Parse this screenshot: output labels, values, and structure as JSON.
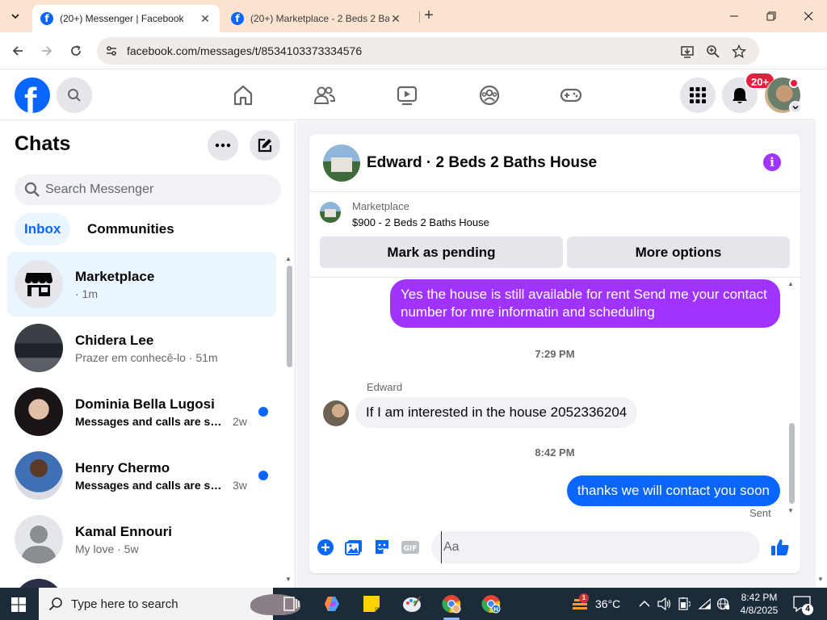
{
  "browser": {
    "tabs": [
      {
        "title": "(20+) Messenger | Facebook",
        "active": true
      },
      {
        "title": "(20+) Marketplace - 2 Beds 2 Baths",
        "active": false
      }
    ],
    "url": "facebook.com/messages/t/8534103373334576"
  },
  "header": {
    "notification_badge": "20+"
  },
  "chats": {
    "title": "Chats",
    "search_placeholder": "Search Messenger",
    "filters": {
      "inbox": "Inbox",
      "communities": "Communities"
    },
    "items": [
      {
        "name": "Marketplace",
        "preview": "",
        "time": "· 1m",
        "unread": false,
        "selected": true
      },
      {
        "name": "Chidera Lee",
        "preview": "Prazer em conhecê-lo",
        "time": " · 51m",
        "unread": false
      },
      {
        "name": "Dominia Bella Lugosi",
        "preview": "Messages and calls are sec...",
        "time": "2w",
        "unread": true
      },
      {
        "name": "Henry Chermo",
        "preview": "Messages and calls are sec...",
        "time": "3w",
        "unread": true
      },
      {
        "name": "Kamal Ennouri",
        "preview": "My love",
        "time": " · 5w",
        "unread": false
      }
    ]
  },
  "conversation": {
    "title": "Edward · 2 Beds 2 Baths House",
    "listing_label": "Marketplace",
    "listing_price": "$900 - 2 Beds 2 Baths House",
    "mark_pending_label": "Mark as pending",
    "more_options_label": "More options",
    "messages": [
      {
        "from": "me",
        "text": "Yes the house is still available for rent Send me your contact number for mre informatin and  scheduling"
      },
      {
        "timestamp": "7:29 PM"
      },
      {
        "from": "Edward",
        "sender_label": "Edward",
        "text": "If I am interested in the house 2052336204"
      },
      {
        "timestamp": "8:42 PM"
      },
      {
        "from": "me",
        "text": "thanks we will contact you soon",
        "status": "Sent"
      }
    ],
    "composer_placeholder": "Aa"
  },
  "taskbar": {
    "search_placeholder": "Type here to search",
    "weather_badge": "1",
    "temperature": "36°C",
    "time": "8:42 PM",
    "date": "4/8/2025",
    "notification_count": "4"
  },
  "colors": {
    "facebook_blue": "#0866ff",
    "purple_bubble": "#a033ff",
    "tab_bar": "#fbe3cf",
    "taskbar": "#1c2b3a"
  }
}
